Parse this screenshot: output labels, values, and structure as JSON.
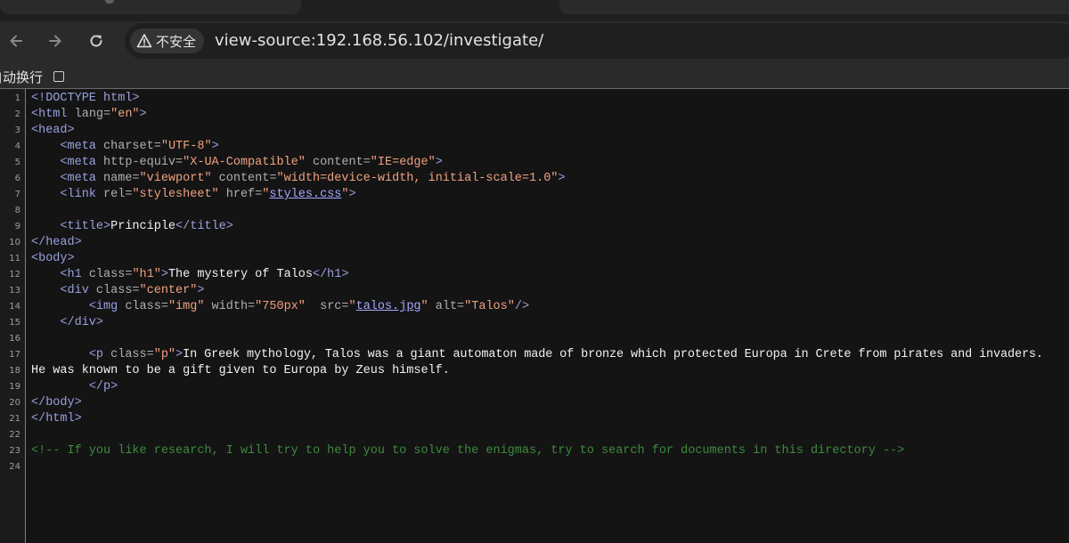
{
  "browser": {
    "security_label": "不安全",
    "url": "view-source:192.168.56.102/investigate/",
    "icons": {
      "back": "back-arrow-icon",
      "forward": "forward-arrow-icon",
      "reload": "reload-icon",
      "security": "warning-triangle-icon"
    }
  },
  "viewsource": {
    "wrap_label": "自动换行",
    "line_numbers": [
      "1",
      "2",
      "3",
      "4",
      "5",
      "6",
      "7",
      "8",
      "9",
      "10",
      "11",
      "12",
      "13",
      "14",
      "15",
      "16",
      "17",
      "18",
      "19",
      "20",
      "21",
      "22",
      "23",
      "24"
    ],
    "lines": {
      "l1": [
        "<!DOCTYPE html>"
      ],
      "l2": [
        "<html",
        " lang=",
        "\"en\"",
        ">"
      ],
      "l3": [
        "<head>"
      ],
      "l4": [
        "    ",
        "<meta",
        " charset=",
        "\"UTF-8\"",
        ">"
      ],
      "l5": [
        "    ",
        "<meta",
        " http-equiv=",
        "\"X-UA-Compatible\"",
        " content=",
        "\"IE=edge\"",
        ">"
      ],
      "l6": [
        "    ",
        "<meta",
        " name=",
        "\"viewport\"",
        " content=",
        "\"width=device-width, initial-scale=1.0\"",
        ">"
      ],
      "l7": [
        "    ",
        "<link",
        " rel=",
        "\"stylesheet\"",
        " href=",
        "\"",
        "styles.css",
        "\"",
        ">"
      ],
      "l8": [
        ""
      ],
      "l9": [
        "    ",
        "<title>",
        "Principle",
        "</title>"
      ],
      "l10": [
        "</head>"
      ],
      "l11": [
        "<body>"
      ],
      "l12": [
        "    ",
        "<h1",
        " class=",
        "\"h1\"",
        ">",
        "The mystery of Talos",
        "</h1>"
      ],
      "l13": [
        "    ",
        "<div",
        " class=",
        "\"center\"",
        ">"
      ],
      "l14": [
        "        ",
        "<img",
        " class=",
        "\"img\"",
        " width=",
        "\"750px\"",
        "  src=",
        "\"",
        "talos.jpg",
        "\"",
        " alt=",
        "\"Talos\"",
        "/>"
      ],
      "l15": [
        "    ",
        "</div>"
      ],
      "l16": [
        ""
      ],
      "l17": [
        "        ",
        "<p",
        " class=",
        "\"p\"",
        ">",
        "In Greek mythology, Talos was a giant automaton made of bronze which protected Europa in Crete from pirates and invaders."
      ],
      "l18": [
        "He was known to be a gift given to Europa by Zeus himself."
      ],
      "l19": [
        "        ",
        "</p>"
      ],
      "l20": [
        "</body>"
      ],
      "l21": [
        "</html>"
      ],
      "l22": [
        ""
      ],
      "l23": [
        "<!-- If you like research, I will try to help you to solve the enigmas, try to search for documents in this directory -->"
      ],
      "l24": [
        ""
      ]
    }
  }
}
